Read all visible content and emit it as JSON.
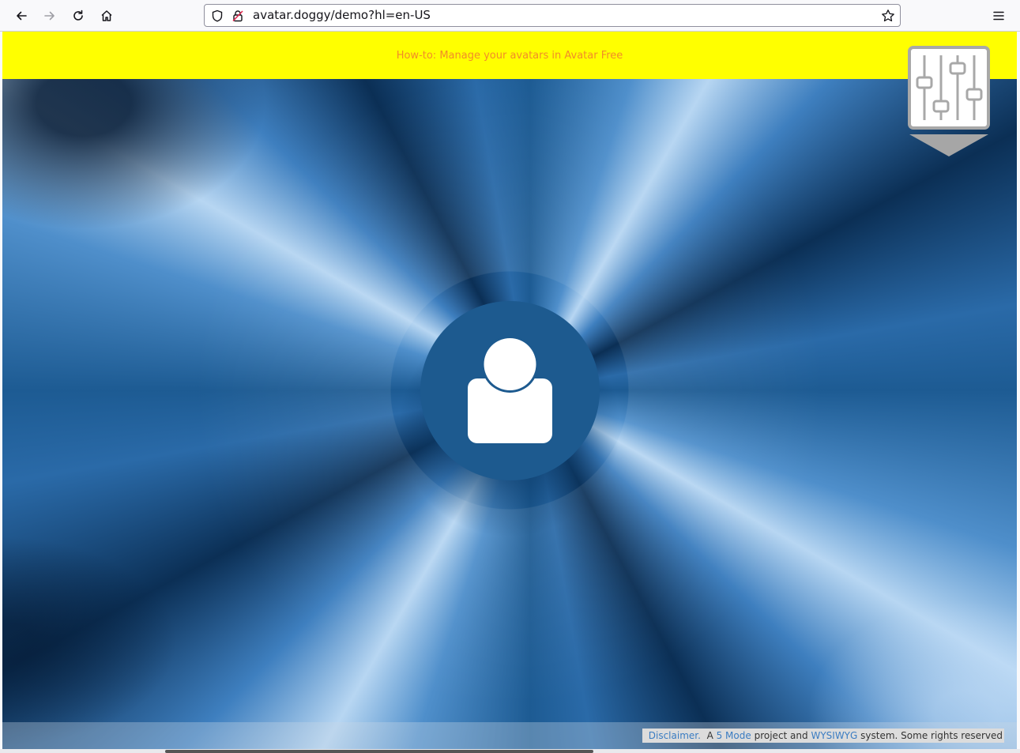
{
  "browser": {
    "url": "avatar.doggy/demo?hl=en-US",
    "icons": [
      "back-arrow-icon",
      "forward-arrow-icon",
      "reload-icon",
      "home-icon",
      "shield-icon",
      "insecure-lock-icon",
      "star-icon",
      "hamburger-menu-icon"
    ]
  },
  "page": {
    "howto_link": "How-to: Manage your avatars in Avatar Free",
    "colors": {
      "banner": "#ffff00",
      "banner_link": "#f28c28",
      "avatar_circle": "#1d5a8f",
      "footer_link": "#3a7cc2"
    },
    "settings_icon": "sliders-icon",
    "avatar_icon": "user-silhouette-icon",
    "footer": {
      "disclaimer": "Disclaimer.",
      "text_a": "A",
      "five_mode": "5 Mode",
      "text_project": "project and",
      "wysiwyg": "WYSIWYG",
      "text_system": "system. Some rights reserved"
    }
  }
}
